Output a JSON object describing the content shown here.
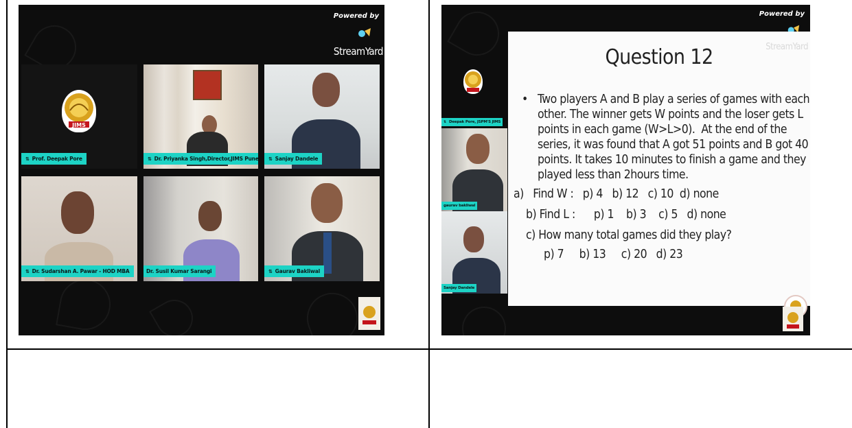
{
  "left_panel": {
    "powered_by": "Powered by",
    "brand": "StreamYard",
    "emblem_text": "JIMS",
    "tiles": [
      {
        "name": "Prof. Deepak Pore"
      },
      {
        "name": "Dr. Priyanka Singh,Director,JIMS Pune"
      },
      {
        "name": "Sanjay Dandele"
      },
      {
        "name": "Dr. Sudarshan A. Pawar - HOD MBA"
      },
      {
        "name": "Dr. Susil Kumar Sarangi"
      },
      {
        "name": "Gaurav Bakliwal"
      }
    ]
  },
  "right_panel": {
    "powered_by": "Powered by",
    "brand": "StreamYard",
    "emblem_text": "JIMS",
    "side_tiles": [
      {
        "name": "Deepak Pore, JSPM'S JIMS"
      },
      {
        "name": "gaurav bakliwal"
      },
      {
        "name": "Sanjay Dandele"
      }
    ],
    "slide": {
      "title": "Question 12",
      "bullet": "•",
      "lines": [
        "Two players A and B play a series of games with each",
        "other. The winner gets W points and the loser gets L",
        "points in each game (W>L>0).  At the end of the",
        "series, it was found that A got 51 points and B got 40",
        "points. It takes 10 minutes to finish a game and they",
        "played less than 2hours time."
      ],
      "option_a": "a)   Find W :   p) 4   b) 12   c) 10  d) none",
      "option_b": "b) Find L :      p) 1    b) 3    c) 5   d) none",
      "option_c": "c) How many total games did they play?",
      "option_c_answers": "p) 7     b) 13     c) 20   d) 23"
    }
  }
}
